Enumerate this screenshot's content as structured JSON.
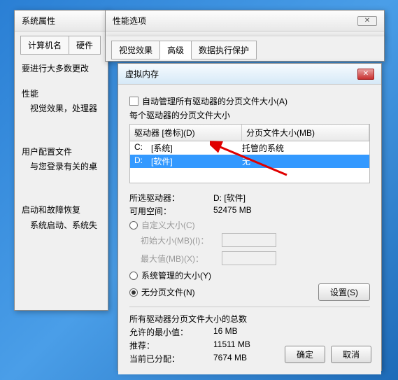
{
  "dialog1": {
    "title": "系统属性",
    "tabs": [
      "计算机名",
      "硬件"
    ],
    "line1": "要进行大多数更改",
    "perf_h": "性能",
    "perf_sub": "视觉效果，处理器",
    "user_h": "用户配置文件",
    "user_sub": "与您登录有关的桌",
    "startup_h": "启动和故障恢复",
    "startup_sub": "系统启动、系统失"
  },
  "dialog2": {
    "title": "性能选项",
    "tabs": [
      "视觉效果",
      "高级",
      "数据执行保护"
    ],
    "active": 1
  },
  "dialog3": {
    "title": "虚拟内存",
    "auto_label": "自动管理所有驱动器的分页文件大小(A)",
    "each_label": "每个驱动器的分页文件大小",
    "col_drive": "驱动器 [卷标](D)",
    "col_size": "分页文件大小(MB)",
    "rows": [
      {
        "d": "C:",
        "label": "[系统]",
        "val": "托管的系统"
      },
      {
        "d": "D:",
        "label": "[软件]",
        "val": "无"
      }
    ],
    "selected_row": 1,
    "sel_drive_label": "所选驱动器：",
    "sel_drive_val": "D:   [软件]",
    "avail_label": "可用空间：",
    "avail_val": "52475 MB",
    "custom": "自定义大小(C)",
    "init": "初始大小(MB)(I)：",
    "max": "最大值(MB)(X)：",
    "sys_managed": "系统管理的大小(Y)",
    "no_page": "无分页文件(N)",
    "set_btn": "设置(S)",
    "total_h": "所有驱动器分页文件大小的总数",
    "min_label": "允许的最小值：",
    "min_val": "16 MB",
    "rec_label": "推荐：",
    "rec_val": "11511 MB",
    "cur_label": "当前已分配：",
    "cur_val": "7674 MB",
    "ok": "确定",
    "cancel": "取消"
  }
}
